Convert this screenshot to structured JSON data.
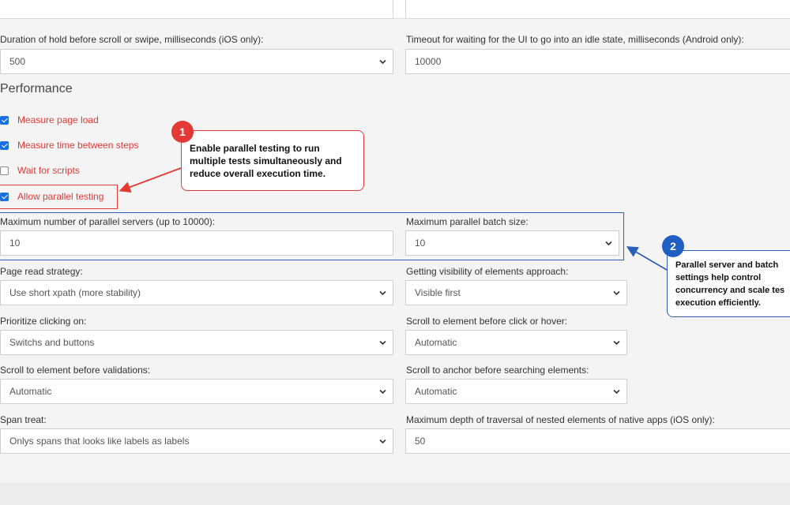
{
  "section": {
    "performance_title": "Performance"
  },
  "fields": {
    "hold_duration": {
      "label": "Duration of hold before scroll or swipe, milliseconds (iOS only):",
      "value": "500"
    },
    "idle_timeout": {
      "label": "Timeout for waiting for the UI to go into an idle state, milliseconds (Android only):",
      "value": "10000"
    },
    "max_servers": {
      "label": "Maximum number of parallel servers (up to 10000):",
      "value": "10"
    },
    "batch_size": {
      "label": "Maximum parallel batch size:",
      "value": "10"
    },
    "page_read": {
      "label": "Page read strategy:",
      "value": "Use short xpath (more stability)"
    },
    "visibility": {
      "label": "Getting visibility of elements approach:",
      "value": "Visible first"
    },
    "prioritize": {
      "label": "Prioritize clicking on:",
      "value": "Switchs and buttons"
    },
    "scroll_click": {
      "label": "Scroll to element before click or hover:",
      "value": "Automatic"
    },
    "scroll_validations": {
      "label": "Scroll to element before validations:",
      "value": "Automatic"
    },
    "scroll_anchor": {
      "label": "Scroll to anchor before searching elements:",
      "value": "Automatic"
    },
    "span_treat": {
      "label": "Span treat:",
      "value": "Onlys spans that looks like labels as labels"
    },
    "max_depth": {
      "label": "Maximum depth of traversal of nested elements of native apps (iOS only):",
      "value": "50"
    }
  },
  "checkboxes": [
    {
      "label": "Measure page load",
      "checked": true
    },
    {
      "label": "Measure time between steps",
      "checked": true
    },
    {
      "label": "Wait for scripts",
      "checked": false
    },
    {
      "label": "Allow parallel testing",
      "checked": true
    }
  ],
  "annotations": {
    "one": {
      "number": "1",
      "line1": "Enable parallel testing to run",
      "line2": "multiple tests simultaneously and",
      "line3": "reduce overall execution time."
    },
    "two": {
      "number": "2",
      "line1": "Parallel server and batch",
      "line2": "settings help control",
      "line3": "concurrency and scale tes",
      "line4": "execution efficiently."
    }
  },
  "colors": {
    "annotation_red": "#e53935",
    "annotation_blue": "#2e5fb8",
    "checkbox_blue": "#1a6fe0"
  },
  "icons": {
    "dropdown": "chevron-down-icon",
    "checkbox": "checkmark-icon"
  }
}
